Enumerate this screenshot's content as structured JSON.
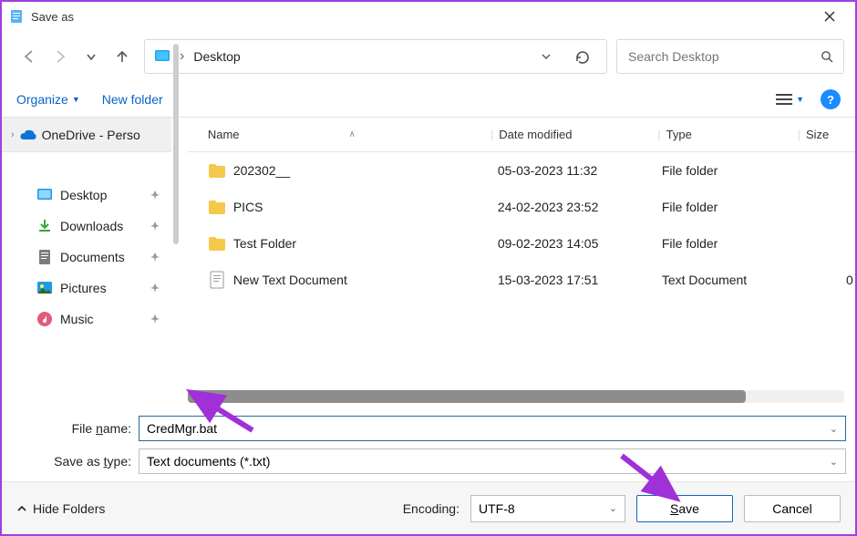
{
  "window": {
    "title": "Save as"
  },
  "breadcrumb": {
    "location": "Desktop"
  },
  "search": {
    "placeholder": "Search Desktop"
  },
  "toolbar": {
    "organize": "Organize",
    "new_folder": "New folder"
  },
  "sidebar": {
    "top": "OneDrive - Perso",
    "items": [
      {
        "label": "Desktop",
        "icon": "desktop",
        "color": "#1e99e6"
      },
      {
        "label": "Downloads",
        "icon": "download",
        "color": "#37a63c"
      },
      {
        "label": "Documents",
        "icon": "document",
        "color": "#7c7c7c"
      },
      {
        "label": "Pictures",
        "icon": "pictures",
        "color": "#1e99e6"
      },
      {
        "label": "Music",
        "icon": "music",
        "color": "#e35b7a"
      }
    ]
  },
  "columns": {
    "name": "Name",
    "date": "Date modified",
    "type": "Type",
    "size": "Size"
  },
  "files": [
    {
      "name": "202302__",
      "date": "05-03-2023 11:32",
      "type": "File folder",
      "size": "",
      "kind": "folder"
    },
    {
      "name": "PICS",
      "date": "24-02-2023 23:52",
      "type": "File folder",
      "size": "",
      "kind": "folder"
    },
    {
      "name": "Test Folder",
      "date": "09-02-2023 14:05",
      "type": "File folder",
      "size": "",
      "kind": "folder"
    },
    {
      "name": "New Text Document",
      "date": "15-03-2023 17:51",
      "type": "Text Document",
      "size": "0",
      "kind": "text"
    }
  ],
  "form": {
    "filename_label": "File name:",
    "filename_value": "CredMgr.bat",
    "savetype_label": "Save as type:",
    "savetype_value": "Text documents (*.txt)"
  },
  "footer": {
    "hide_folders": "Hide Folders",
    "encoding_label": "Encoding:",
    "encoding_value": "UTF-8",
    "save": "Save",
    "cancel": "Cancel"
  }
}
